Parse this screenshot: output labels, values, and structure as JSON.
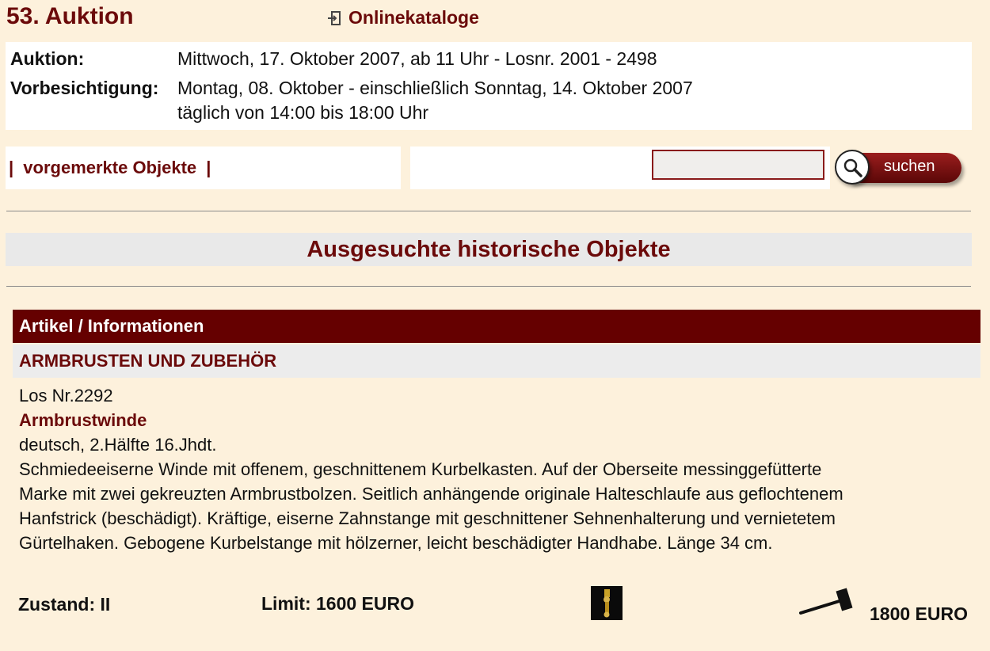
{
  "page": {
    "title": "53. Auktion",
    "catalog_link_label": "Onlinekataloge"
  },
  "auction_info": {
    "auction_label": "Auktion:",
    "auction_value": "Mittwoch, 17. Oktober 2007, ab 11 Uhr - Losnr. 2001 - 2498",
    "preview_label": "Vorbesichtigung:",
    "preview_value_line1": "Montag, 08. Oktober - einschließlich Sonntag, 14. Oktober 2007",
    "preview_value_line2": "täglich von 14:00 bis 18:00 Uhr"
  },
  "toolbar": {
    "bar_left": "|",
    "marked_objects_label": "vorgemerkte Objekte",
    "bar_right": "|",
    "search_value": "",
    "search_button_label": "suchen"
  },
  "section": {
    "heading": "Ausgesuchte historische Objekte"
  },
  "table": {
    "header": "Artikel / Informationen",
    "category": "ARMBRUSTEN UND ZUBEHÖR"
  },
  "lot": {
    "number": "Los Nr.2292",
    "name": "Armbrustwinde",
    "origin": "deutsch, 2.Hälfte 16.Jhdt.",
    "description_lines": [
      "Schmiedeeiserne Winde mit offenem, geschnittenem Kurbelkasten. Auf der Oberseite messinggefütterte",
      "Marke mit zwei gekreuzten Armbrustbolzen. Seitlich anhängende originale Halteschlaufe aus geflochtenem",
      "Hanfstrick (beschädigt). Kräftige, eiserne Zahnstange mit geschnittener Sehnenhalterung und vernietetem",
      "Gürtelhaken. Gebogene Kurbelstange mit hölzerner, leicht beschädigter Handhabe. Länge 34 cm."
    ],
    "condition": "Zustand: II",
    "limit": "Limit: 1600 EURO",
    "hammer_price": "1800 EURO"
  },
  "icons": {
    "catalog_link": "arrow-into-box-icon",
    "search_button": "magnifier-icon",
    "thumbnail": "item-thumbnail-icon",
    "hammer": "auction-hammer-icon"
  },
  "colors": {
    "background": "#fdf1dc",
    "accent": "#6b0a0a",
    "header_bar": "#650000"
  }
}
